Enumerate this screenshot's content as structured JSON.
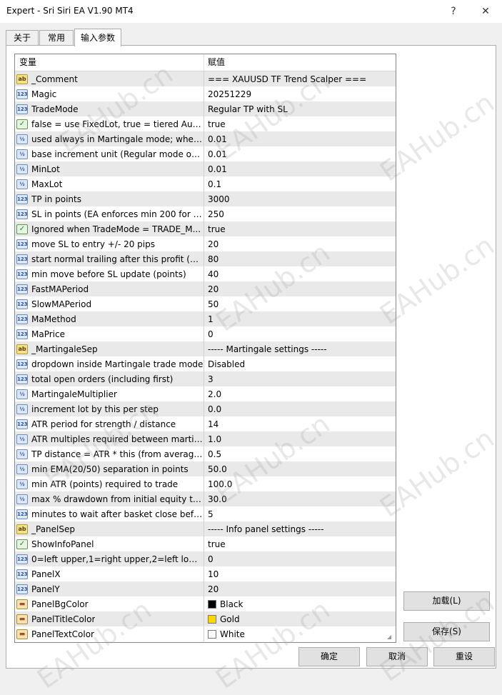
{
  "window": {
    "title": "Expert - Sri Siri EA V1.90 MT4",
    "help_label": "?",
    "close_label": "✕"
  },
  "tabs": [
    {
      "label": "关于"
    },
    {
      "label": "常用"
    },
    {
      "label": "输入参数",
      "active": true
    }
  ],
  "grid": {
    "col_variable": "变量",
    "col_value": "赋值",
    "rows": [
      {
        "type": "ab",
        "icon": "ab",
        "name": "_Comment",
        "value": "=== XAUUSD TF Trend Scalper ==="
      },
      {
        "type": "int",
        "icon": "123",
        "name": "Magic",
        "value": "20251229"
      },
      {
        "type": "int",
        "icon": "123",
        "name": "TradeMode",
        "value": "Regular TP with SL"
      },
      {
        "type": "bool",
        "icon": "✓",
        "name": "false = use FixedLot, true = tiered Auto...",
        "value": "true"
      },
      {
        "type": "dbl",
        "icon": "½",
        "name": "used always in Martingale mode; when ...",
        "value": "0.01"
      },
      {
        "type": "dbl",
        "icon": "½",
        "name": "base increment unit (Regular mode only)",
        "value": "0.01"
      },
      {
        "type": "dbl",
        "icon": "½",
        "name": "MinLot",
        "value": "0.01"
      },
      {
        "type": "dbl",
        "icon": "½",
        "name": "MaxLot",
        "value": "0.1"
      },
      {
        "type": "int",
        "icon": "123",
        "name": "TP in points",
        "value": "3000"
      },
      {
        "type": "int",
        "icon": "123",
        "name": "SL in points (EA enforces min 200 for n...",
        "value": "250"
      },
      {
        "type": "bool",
        "icon": "✓",
        "name": "Ignored when TradeMode = TRADE_M...",
        "value": "true"
      },
      {
        "type": "int",
        "icon": "123",
        "name": "move SL to entry +/- 20 pips",
        "value": "20"
      },
      {
        "type": "int",
        "icon": "123",
        "name": "start normal trailing after this profit (po...",
        "value": "80"
      },
      {
        "type": "int",
        "icon": "123",
        "name": "min move before SL update (points)",
        "value": "40"
      },
      {
        "type": "int",
        "icon": "123",
        "name": "FastMAPeriod",
        "value": "20"
      },
      {
        "type": "int",
        "icon": "123",
        "name": "SlowMAPeriod",
        "value": "50"
      },
      {
        "type": "int",
        "icon": "123",
        "name": "MaMethod",
        "value": "1"
      },
      {
        "type": "int",
        "icon": "123",
        "name": "MaPrice",
        "value": "0"
      },
      {
        "type": "ab",
        "icon": "ab",
        "name": "_MartingaleSep",
        "value": "----- Martingale settings -----"
      },
      {
        "type": "int",
        "icon": "123",
        "name": "dropdown inside Martingale trade mode",
        "value": "Disabled"
      },
      {
        "type": "int",
        "icon": "123",
        "name": "total open orders (including first)",
        "value": "3"
      },
      {
        "type": "dbl",
        "icon": "½",
        "name": "MartingaleMultiplier",
        "value": "2.0"
      },
      {
        "type": "dbl",
        "icon": "½",
        "name": "increment lot by this per step",
        "value": "0.0"
      },
      {
        "type": "int",
        "icon": "123",
        "name": "ATR period for strength / distance",
        "value": "14"
      },
      {
        "type": "dbl",
        "icon": "½",
        "name": "ATR multiples required between martin...",
        "value": "1.0"
      },
      {
        "type": "dbl",
        "icon": "½",
        "name": "TP distance = ATR * this (from average ...",
        "value": "0.5"
      },
      {
        "type": "dbl",
        "icon": "½",
        "name": "min EMA(20/50) separation in points",
        "value": "50.0"
      },
      {
        "type": "dbl",
        "icon": "½",
        "name": "min ATR (points) required to trade",
        "value": "100.0"
      },
      {
        "type": "dbl",
        "icon": "½",
        "name": "max % drawdown from initial equity to ...",
        "value": "30.0"
      },
      {
        "type": "int",
        "icon": "123",
        "name": "minutes to wait after basket close befor...",
        "value": "5"
      },
      {
        "type": "ab",
        "icon": "ab",
        "name": "_PanelSep",
        "value": "----- Info panel settings -----"
      },
      {
        "type": "bool",
        "icon": "✓",
        "name": "ShowInfoPanel",
        "value": "true"
      },
      {
        "type": "int",
        "icon": "123",
        "name": "0=left upper,1=right upper,2=left lower...",
        "value": "0"
      },
      {
        "type": "int",
        "icon": "123",
        "name": "PanelX",
        "value": "10"
      },
      {
        "type": "int",
        "icon": "123",
        "name": "PanelY",
        "value": "20"
      },
      {
        "type": "color",
        "icon": "▬",
        "name": "PanelBgColor",
        "value": "Black",
        "swatch": "#000000"
      },
      {
        "type": "color",
        "icon": "▬",
        "name": "PanelTitleColor",
        "value": "Gold",
        "swatch": "#ffd700"
      },
      {
        "type": "color",
        "icon": "▬",
        "name": "PanelTextColor",
        "value": "White",
        "swatch": "#ffffff"
      }
    ]
  },
  "side_buttons": {
    "load_label": "加载(L)",
    "save_label": "保存(S)"
  },
  "footer_buttons": {
    "ok_label": "确定",
    "cancel_label": "取消",
    "reset_label": "重设"
  },
  "watermark": "EAHub.cn"
}
